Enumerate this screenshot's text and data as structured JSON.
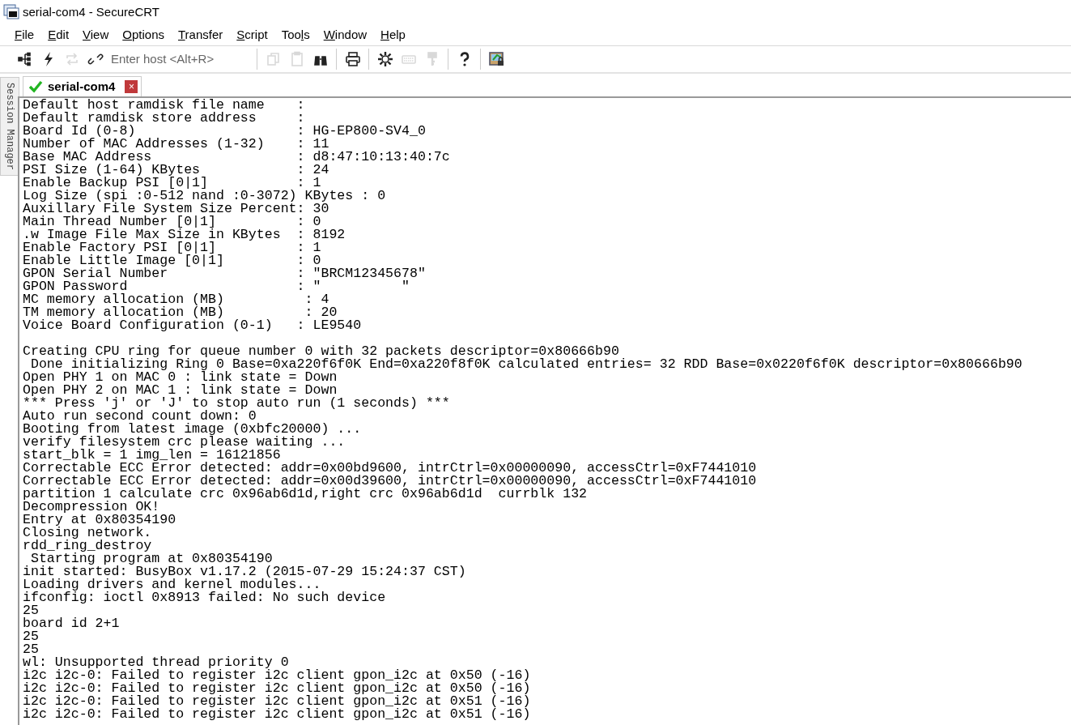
{
  "window": {
    "title": "serial-com4 - SecureCRT"
  },
  "menu": [
    {
      "key": "F",
      "after": "ile"
    },
    {
      "key": "E",
      "after": "dit"
    },
    {
      "key": "V",
      "after": "iew"
    },
    {
      "key": "O",
      "after": "ptions"
    },
    {
      "key": "T",
      "after": "ransfer"
    },
    {
      "key": "S",
      "after": "cript"
    },
    {
      "before": "Too",
      "key": "l",
      "after": "s"
    },
    {
      "key": "W",
      "after": "indow"
    },
    {
      "key": "H",
      "after": "elp"
    }
  ],
  "toolbar": {
    "left_buttons": [
      {
        "disabled": false
      },
      {
        "disabled": false
      },
      {
        "disabled": true
      },
      {
        "disabled": false
      }
    ],
    "host_field": {
      "placeholder": "Enter host <Alt+R>"
    },
    "groups": [
      [
        {
          "disabled": true
        },
        {
          "disabled": true
        },
        {
          "disabled": false
        }
      ],
      [
        {
          "disabled": false
        }
      ],
      [
        {
          "disabled": false
        },
        {
          "disabled": true
        },
        {
          "disabled": true
        }
      ],
      [
        {
          "disabled": false
        }
      ],
      [
        {
          "disabled": false
        }
      ]
    ]
  },
  "side_panel": {
    "label": "Session Manager"
  },
  "tabs": [
    {
      "label": "serial-com4",
      "selected": true,
      "connected": true,
      "close": "×"
    }
  ],
  "terminal": {
    "blocks": [
      [
        "Default host ramdisk file name    :",
        "Default ramdisk store address     :",
        "Board Id (0-8)                    : HG-EP800-SV4_0",
        "Number of MAC Addresses (1-32)    : 11",
        "Base MAC Address                  : d8:47:10:13:40:7c",
        "PSI Size (1-64) KBytes            : 24",
        "Enable Backup PSI [0|1]           : 1",
        "Log Size (spi :0-512 nand :0-3072) KBytes : 0",
        "Auxillary File System Size Percent: 30",
        "Main Thread Number [0|1]          : 0",
        ".w Image File Max Size in KBytes  : 8192",
        "Enable Factory PSI [0|1]          : 1",
        "Enable Little Image [0|1]         : 0",
        "GPON Serial Number                : \"BRCM12345678\"",
        "GPON Password                     : \"          \"",
        "MC memory allocation (MB)          : 4",
        "TM memory allocation (MB)          : 20",
        "Voice Board Configuration (0-1)   : LE9540"
      ],
      [
        "Creating CPU ring for queue number 0 with 32 packets descriptor=0x80666b90",
        " Done initializing Ring 0 Base=0xa220f6f0K End=0xa220f8f0K calculated entries= 32 RDD Base=0x0220f6f0K descriptor=0x80666b90",
        "Open PHY 1 on MAC 0 : link state = Down",
        "Open PHY 2 on MAC 1 : link state = Down",
        "*** Press 'j' or 'J' to stop auto run (1 seconds) ***",
        "Auto run second count down: 0",
        "Booting from latest image (0xbfc20000) ...",
        "verify filesystem crc please waiting ...",
        "start_blk = 1 img_len = 16121856",
        "Correctable ECC Error detected: addr=0x00bd9600, intrCtrl=0x00000090, accessCtrl=0xF7441010",
        "Correctable ECC Error detected: addr=0x00d39600, intrCtrl=0x00000090, accessCtrl=0xF7441010",
        "partition 1 calculate crc 0x96ab6d1d,right crc 0x96ab6d1d  currblk 132",
        "Decompression OK!",
        "Entry at 0x80354190",
        "Closing network.",
        "rdd_ring_destroy",
        " Starting program at 0x80354190",
        "init started: BusyBox v1.17.2 (2015-07-29 15:24:37 CST)",
        "Loading drivers and kernel modules...",
        "ifconfig: ioctl 0x8913 failed: No such device",
        "25",
        "board id 2+1",
        "25",
        "25",
        "wl: Unsupported thread priority 0",
        "i2c i2c-0: Failed to register i2c client gpon_i2c at 0x50 (-16)",
        "i2c i2c-0: Failed to register i2c client gpon_i2c at 0x50 (-16)",
        "i2c i2c-0: Failed to register i2c client gpon_i2c at 0x51 (-16)",
        "i2c i2c-0: Failed to register i2c client gpon_i2c at 0x51 (-16)"
      ]
    ]
  }
}
